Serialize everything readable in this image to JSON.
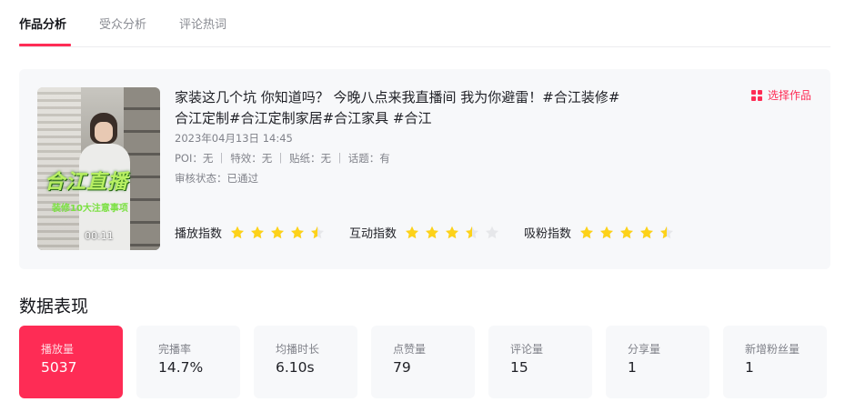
{
  "tabs": [
    {
      "label": "作品分析",
      "active": true
    },
    {
      "label": "受众分析",
      "active": false
    },
    {
      "label": "评论热词",
      "active": false
    }
  ],
  "work": {
    "title": "家装这几个坑 你知道吗？ 今晚八点来我直播间 我为你避雷！#合江装修#合江定制#合江定制家居#合江家具 #合江",
    "date": "2023年04月13日 14:45",
    "meta": "POI：无 ｜ 特效：无 ｜ 贴纸：无 ｜ 话题：有",
    "review": "审核状态：已通过",
    "thumbnail": {
      "overlay_title": "合江直播",
      "overlay_sub": "装修10大注意事项",
      "duration": "00:11"
    },
    "select_label": "选择作品",
    "select_icon": "grid-icon"
  },
  "indices": [
    {
      "label": "播放指数",
      "rating": 4.5
    },
    {
      "label": "互动指数",
      "rating": 3.5
    },
    {
      "label": "吸粉指数",
      "rating": 4.5
    }
  ],
  "section_title": "数据表现",
  "metrics": [
    {
      "label": "播放量",
      "value": "5037",
      "active": true
    },
    {
      "label": "完播率",
      "value": "14.7%",
      "active": false
    },
    {
      "label": "均播时长",
      "value": "6.10s",
      "active": false
    },
    {
      "label": "点赞量",
      "value": "79",
      "active": false
    },
    {
      "label": "评论量",
      "value": "15",
      "active": false
    },
    {
      "label": "分享量",
      "value": "1",
      "active": false
    },
    {
      "label": "新增粉丝量",
      "value": "1",
      "active": false
    }
  ],
  "colors": {
    "accent": "#fe2c55",
    "star_on": "#fdd219",
    "star_off": "#e6e7ea",
    "card_bg": "#f7f8fa"
  }
}
